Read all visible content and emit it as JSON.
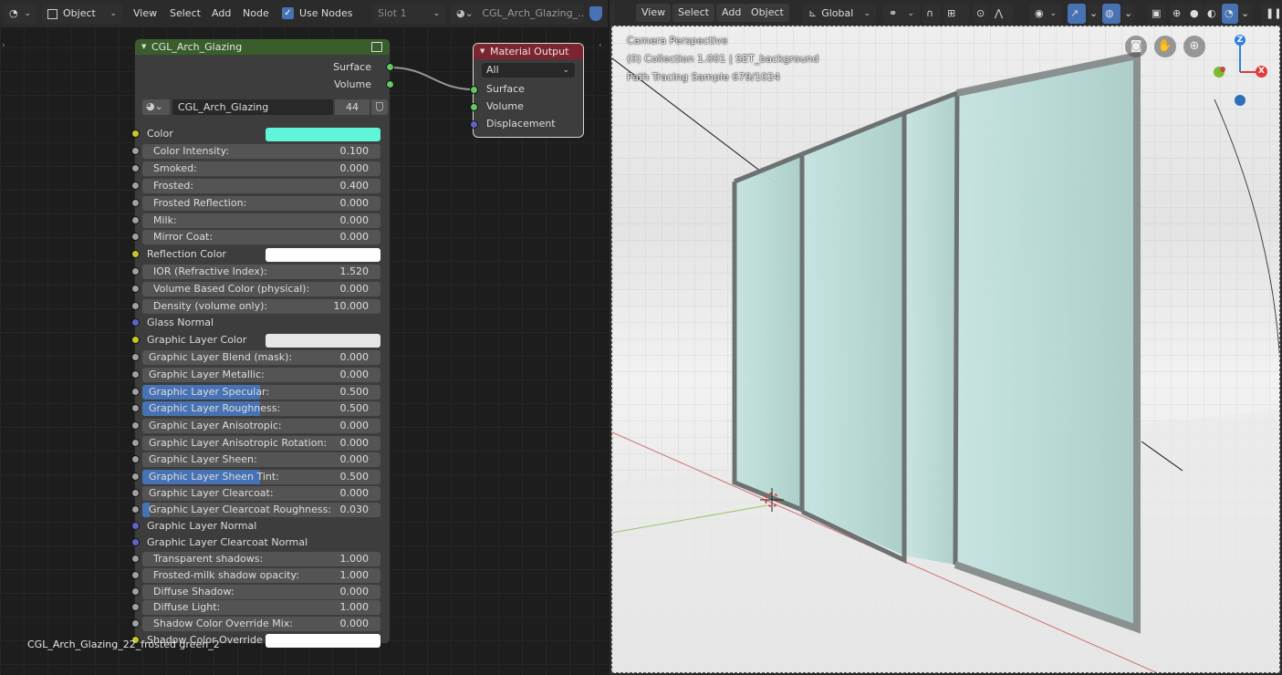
{
  "node_editor": {
    "header": {
      "mode": "Object",
      "menus": [
        "View",
        "Select",
        "Add",
        "Node"
      ],
      "use_nodes_label": "Use Nodes",
      "slot": "Slot 1",
      "material": "CGL_Arch_Glazing_..."
    },
    "glass_node": {
      "title": "CGL_Arch_Glazing",
      "outputs": [
        "Surface",
        "Volume"
      ],
      "material_name": "CGL_Arch_Glazing",
      "material_users": "44",
      "inputs": [
        {
          "label": "Color",
          "kind": "color",
          "color": "#5ff5d9"
        },
        {
          "label": "Color Intensity:",
          "kind": "value",
          "value": "0.100"
        },
        {
          "label": "Smoked:",
          "kind": "value",
          "value": "0.000"
        },
        {
          "label": "Frosted:",
          "kind": "value",
          "value": "0.400"
        },
        {
          "label": "Frosted Reflection:",
          "kind": "value",
          "value": "0.000"
        },
        {
          "label": "Milk:",
          "kind": "value",
          "value": "0.000"
        },
        {
          "label": "Mirror Coat:",
          "kind": "value",
          "value": "0.000"
        },
        {
          "label": "Reflection Color",
          "kind": "color",
          "color": "#ffffff"
        },
        {
          "label": "IOR (Refractive Index):",
          "kind": "value",
          "value": "1.520"
        },
        {
          "label": "Volume Based Color (physical):",
          "kind": "value",
          "value": "0.000"
        },
        {
          "label": "Density (volume only):",
          "kind": "value",
          "value": "10.000"
        },
        {
          "label": "Glass Normal",
          "kind": "vector"
        },
        {
          "label": "Graphic Layer Color",
          "kind": "color",
          "color": "#e6e6e6"
        },
        {
          "label": "Graphic Layer Blend (mask):",
          "kind": "factor",
          "value": "0.000",
          "fraction": 0
        },
        {
          "label": "Graphic Layer Metallic:",
          "kind": "factor",
          "value": "0.000",
          "fraction": 0
        },
        {
          "label": "Graphic Layer Specular:",
          "kind": "factor",
          "value": "0.500",
          "fraction": 0.5
        },
        {
          "label": "Graphic Layer Roughness:",
          "kind": "factor",
          "value": "0.500",
          "fraction": 0.5
        },
        {
          "label": "Graphic Layer Anisotropic:",
          "kind": "factor",
          "value": "0.000",
          "fraction": 0
        },
        {
          "label": "Graphic Layer Anisotropic Rotation:",
          "kind": "factor",
          "value": "0.000",
          "fraction": 0
        },
        {
          "label": "Graphic Layer Sheen:",
          "kind": "factor",
          "value": "0.000",
          "fraction": 0
        },
        {
          "label": "Graphic Layer Sheen Tint:",
          "kind": "factor",
          "value": "0.500",
          "fraction": 0.5
        },
        {
          "label": "Graphic Layer Clearcoat:",
          "kind": "factor",
          "value": "0.000",
          "fraction": 0
        },
        {
          "label": "Graphic Layer Clearcoat Roughness:",
          "kind": "factor",
          "value": "0.030",
          "fraction": 0.03
        },
        {
          "label": "Graphic Layer Normal",
          "kind": "vector"
        },
        {
          "label": "Graphic Layer Clearcoat Normal",
          "kind": "vector"
        },
        {
          "label": "Transparent shadows:",
          "kind": "value",
          "value": "1.000"
        },
        {
          "label": "Frosted-milk shadow opacity:",
          "kind": "value",
          "value": "1.000"
        },
        {
          "label": "Diffuse Shadow:",
          "kind": "value",
          "value": "0.000"
        },
        {
          "label": "Diffuse Light:",
          "kind": "value",
          "value": "1.000"
        },
        {
          "label": "Shadow Color Override Mix:",
          "kind": "value",
          "value": "0.000"
        },
        {
          "label": "Shadow Color Override",
          "kind": "color",
          "color": "#ffffff"
        }
      ]
    },
    "output_node": {
      "title": "Material Output",
      "target": "All",
      "inputs": [
        "Surface",
        "Volume",
        "Displacement"
      ]
    },
    "footer_label": "CGL_Arch_Glazing_22_frosted green_2"
  },
  "viewport": {
    "header": {
      "menus": [
        "View",
        "Select",
        "Add",
        "Object"
      ],
      "orientation": "Global"
    },
    "overlay": {
      "line1": "Camera Perspective",
      "line2": "(0) Collection 1.001 | SET_background",
      "line3": "Path Tracing Sample 679/1024"
    },
    "gizmo": {
      "z": "Z",
      "x": "X"
    }
  },
  "colors": {
    "node_header_group": "#3a5d2c",
    "node_header_output": "#7c2430",
    "accent_blue": "#4772b3"
  }
}
